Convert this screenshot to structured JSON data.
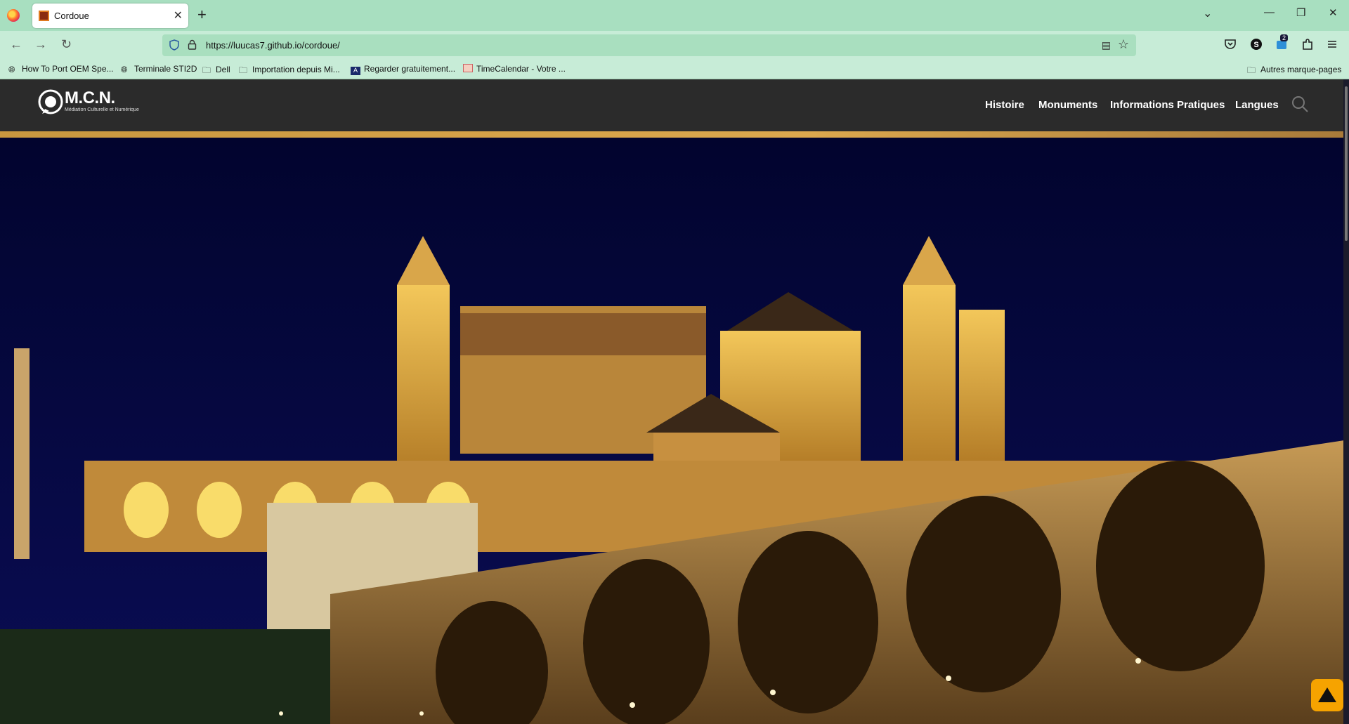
{
  "browser": {
    "tab_title": "Cordoue",
    "url": "https://luucas7.github.io/cordoue/",
    "extension_badge": "2",
    "bookmarks": [
      {
        "label": "How To Port OEM Spe...",
        "icon": "globe-icon"
      },
      {
        "label": "Terminale STI2D",
        "icon": "globe-icon"
      },
      {
        "label": "Dell",
        "icon": "folder-icon"
      },
      {
        "label": "Importation depuis Mi...",
        "icon": "folder-icon"
      },
      {
        "label": "Regarder gratuitement...",
        "icon": "site-icon"
      },
      {
        "label": "TimeCalendar - Votre ...",
        "icon": "calendar-icon"
      }
    ],
    "other_bookmarks": "Autres marque-pages"
  },
  "site": {
    "logo_name": "M.C.N.",
    "logo_tagline": "Médiation Culturelle et Numérique",
    "menu": [
      "Histoire",
      "Monuments",
      "Informations Pratiques",
      "Langues"
    ],
    "accent_color": "#dca84e",
    "header_color": "#2b2b2b",
    "scroll_top_color": "#f6a300"
  },
  "hero": {
    "image": "Mezquita-Catedral de Córdoba illuminated at night with Roman bridge",
    "sky_color": "#05063a"
  }
}
